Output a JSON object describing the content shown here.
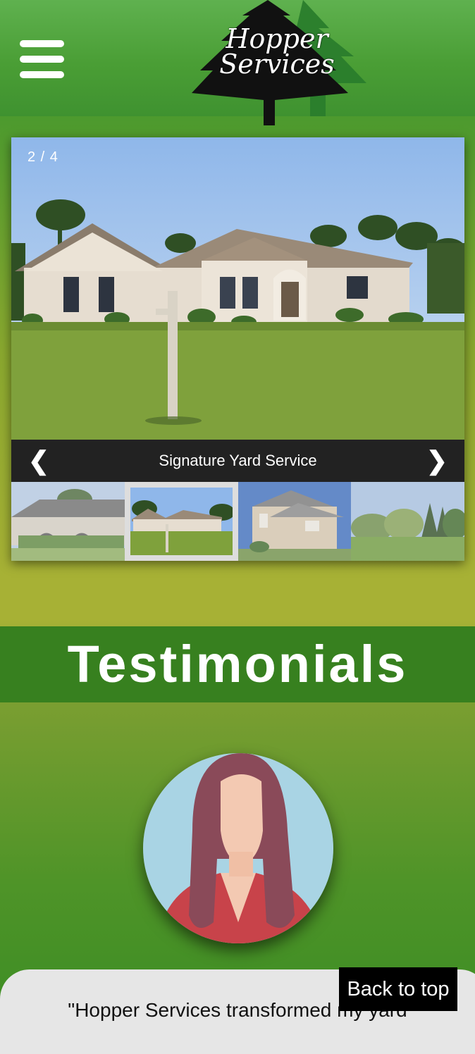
{
  "header": {
    "menu_icon": "hamburger-menu-icon",
    "logo_line1": "Hopper",
    "logo_line2": "Services",
    "logo_icon": "pine-tree-icon",
    "brand_color": "#4a9e35"
  },
  "slider": {
    "counter": "2 / 4",
    "caption": "Signature Yard Service",
    "prev_icon": "chevron-left-icon",
    "next_icon": "chevron-right-icon",
    "prev_glyph": "❮",
    "next_glyph": "❯",
    "active_index": 2,
    "total": 4,
    "thumbnails": [
      "house-with-hedges",
      "house-with-yard-sign",
      "two-story-house",
      "open-lawn-with-trees"
    ]
  },
  "testimonials": {
    "heading": "Testimonials",
    "band_color": "#37801f",
    "avatar_icon": "woman-avatar-icon",
    "quote": "\"Hopper Services transformed my yard"
  },
  "back_to_top": "Back to top"
}
